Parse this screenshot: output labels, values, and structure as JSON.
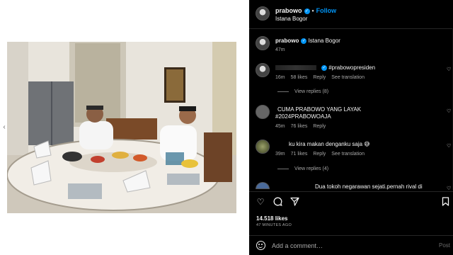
{
  "header": {
    "username": "prabowo",
    "separator": "•",
    "follow_label": "Follow",
    "location": "Istana Bogor"
  },
  "caption": {
    "username": "prabowo",
    "text": "Istana Bogor",
    "time": "47m"
  },
  "comments": [
    {
      "text": "#prabowopresiden",
      "time": "16m",
      "likes": "58 likes",
      "reply": "Reply",
      "translate": "See translation",
      "view_replies": "View replies (8)"
    },
    {
      "text_line1": "CUMA PRABOWO YANG LAYAK",
      "text_line2": "#2024PRABOWOAJA",
      "time": "45m",
      "likes": "76 likes",
      "reply": "Reply"
    },
    {
      "text": "ku kira makan denganku saja 😅",
      "time": "39m",
      "likes": "71 likes",
      "reply": "Reply",
      "translate": "See translation",
      "view_replies": "View replies (4)"
    },
    {
      "text": "Dua tokoh negarawan sejati.pernah rival di"
    }
  ],
  "stats": {
    "likes": "14.518 likes",
    "time_ago": "47 MINUTES AGO"
  },
  "comment_box": {
    "placeholder": "Add a comment…",
    "post_label": "Post"
  },
  "colors": {
    "panel_bg": "#000000",
    "link_blue": "#0095f6",
    "muted_text": "#a8a8a8"
  },
  "icons": [
    "verified-badge-icon",
    "heart-icon",
    "comment-icon",
    "share-icon",
    "bookmark-icon",
    "emoji-icon",
    "chevron-left-icon"
  ]
}
